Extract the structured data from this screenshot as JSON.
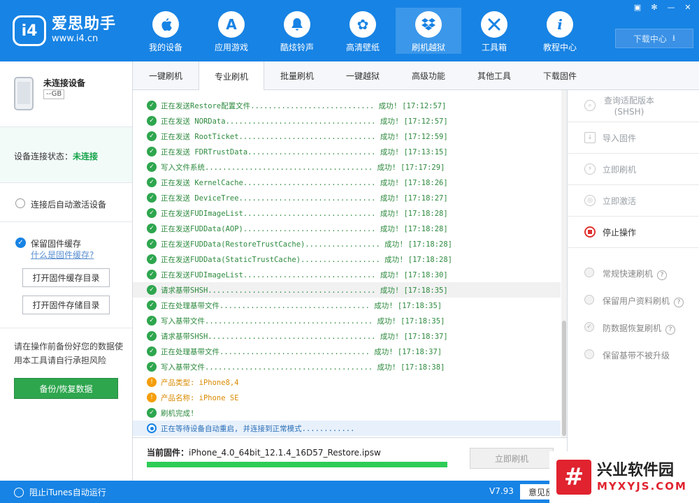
{
  "header": {
    "logo_mark": "i4",
    "logo_name": "爱思助手",
    "logo_url": "www.i4.cn",
    "nav": [
      {
        "label": "我的设备",
        "icon": "apple-icon",
        "glyph": ""
      },
      {
        "label": "应用游戏",
        "icon": "app-store-icon",
        "glyph": "A"
      },
      {
        "label": "酷炫铃声",
        "icon": "bell-icon",
        "glyph": "♪"
      },
      {
        "label": "高清壁纸",
        "icon": "flower-icon",
        "glyph": "✿"
      },
      {
        "label": "刷机越狱",
        "icon": "dropbox-icon",
        "glyph": "◆"
      },
      {
        "label": "工具箱",
        "icon": "tools-icon",
        "glyph": "✕"
      },
      {
        "label": "教程中心",
        "icon": "info-icon",
        "glyph": "i"
      }
    ],
    "active_nav": 4,
    "download_center": "下载中心"
  },
  "device": {
    "name": "未连接设备",
    "capacity": "--GB",
    "status_label": "设备连接状态：",
    "status_value": "未连接",
    "auto_activate": "连接后自动激活设备",
    "keep_cache": "保留固件缓存",
    "what_is_cache": "什么是固件缓存?",
    "open_cache_dir": "打开固件缓存目录",
    "open_storage_dir": "打开固件存储目录",
    "warning": "请在操作前备份好您的数据使用本工具请自行承担风险",
    "backup_button": "备份/恢复数据"
  },
  "tabs": [
    "一键刷机",
    "专业刷机",
    "批量刷机",
    "一键越狱",
    "高级功能",
    "其他工具",
    "下载固件"
  ],
  "active_tab": 1,
  "log": [
    {
      "type": "ok",
      "text": "正在发送Restore配置文件............................ 成功! [17:12:57]"
    },
    {
      "type": "ok",
      "text": "正在发送 NORData.................................. 成功! [17:12:57]"
    },
    {
      "type": "ok",
      "text": "正在发送 RootTicket............................... 成功! [17:12:59]"
    },
    {
      "type": "ok",
      "text": "正在发送 FDRTrustData............................. 成功! [17:13:15]"
    },
    {
      "type": "ok",
      "text": "写入文件系统...................................... 成功! [17:17:29]"
    },
    {
      "type": "ok",
      "text": "正在发送 KernelCache.............................. 成功! [17:18:26]"
    },
    {
      "type": "ok",
      "text": "正在发送 DeviceTree............................... 成功! [17:18:27]"
    },
    {
      "type": "ok",
      "text": "正在发送FUDImageList.............................. 成功! [17:18:28]"
    },
    {
      "type": "ok",
      "text": "正在发送FUDData(AOP).............................. 成功! [17:18:28]"
    },
    {
      "type": "ok",
      "text": "正在发送FUDData(RestoreTrustCache)................. 成功! [17:18:28]"
    },
    {
      "type": "ok",
      "text": "正在发送FUDData(StaticTrustCache).................. 成功! [17:18:28]"
    },
    {
      "type": "ok",
      "text": "正在发送FUDImageList.............................. 成功! [17:18:30]"
    },
    {
      "type": "ok",
      "text": "请求基带SHSH...................................... 成功! [17:18:35]"
    },
    {
      "type": "ok",
      "text": "正在处理基带文件.................................. 成功! [17:18:35]"
    },
    {
      "type": "ok",
      "text": "写入基带文件...................................... 成功! [17:18:35]"
    },
    {
      "type": "ok",
      "text": "请求基带SHSH...................................... 成功! [17:18:37]"
    },
    {
      "type": "ok",
      "text": "正在处理基带文件.................................. 成功! [17:18:37]"
    },
    {
      "type": "ok",
      "text": "写入基带文件...................................... 成功! [17:18:38]"
    },
    {
      "type": "warn",
      "text": "产品类型: iPhone8,4"
    },
    {
      "type": "warn",
      "text": "产品名称: iPhone SE"
    },
    {
      "type": "ok",
      "text": "刷机完成!"
    },
    {
      "type": "wait",
      "text": "正在等待设备自动重启, 并连接到正常模式............"
    }
  ],
  "firmware": {
    "label": "当前固件：",
    "file": "iPhone_4.0_64bit_12.1.4_16D57_Restore.ipsw",
    "progress": 1.0,
    "flash_button": "立即刷机"
  },
  "right_panel": {
    "query_shsh_line1": "查询适配版本",
    "query_shsh_line2": "(SHSH)",
    "import_firmware": "导入固件",
    "flash_now": "立即刷机",
    "activate_now": "立即激活",
    "stop": "停止操作",
    "options": [
      "常规快速刷机",
      "保留用户资料刷机",
      "防数据恢复刷机",
      "保留基带不被升级"
    ]
  },
  "statusbar": {
    "block_itunes": "阻止iTunes自动运行",
    "version": "V7.93",
    "feedback": "意见反"
  },
  "watermark": {
    "mark": "#",
    "name": "兴业软件园",
    "url": "MYXYJS.COM"
  },
  "colors": {
    "brand_blue": "#1783e4",
    "success_green": "#2ea64e",
    "warn_orange": "#f59e0b",
    "stop_red": "#e0322f"
  }
}
